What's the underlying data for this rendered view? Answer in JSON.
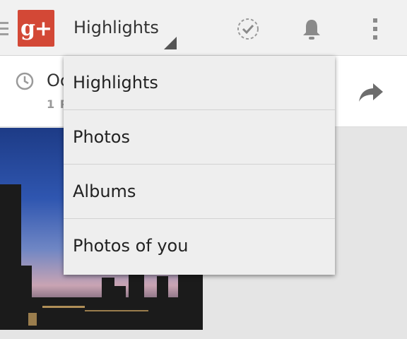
{
  "app": {
    "logo_text": "g+",
    "brand_color": "#d34836"
  },
  "actionbar": {
    "view_selector_label": "Highlights",
    "icons": [
      "navigation-menu-icon",
      "circle-check-icon",
      "bell-icon",
      "overflow-menu-icon"
    ]
  },
  "card": {
    "title": "Oc",
    "meta": "1 P",
    "icons": [
      "clock-icon",
      "share-icon"
    ]
  },
  "dropdown": {
    "items": [
      {
        "label": "Highlights"
      },
      {
        "label": "Photos"
      },
      {
        "label": "Albums"
      },
      {
        "label": "Photos of you"
      }
    ]
  }
}
